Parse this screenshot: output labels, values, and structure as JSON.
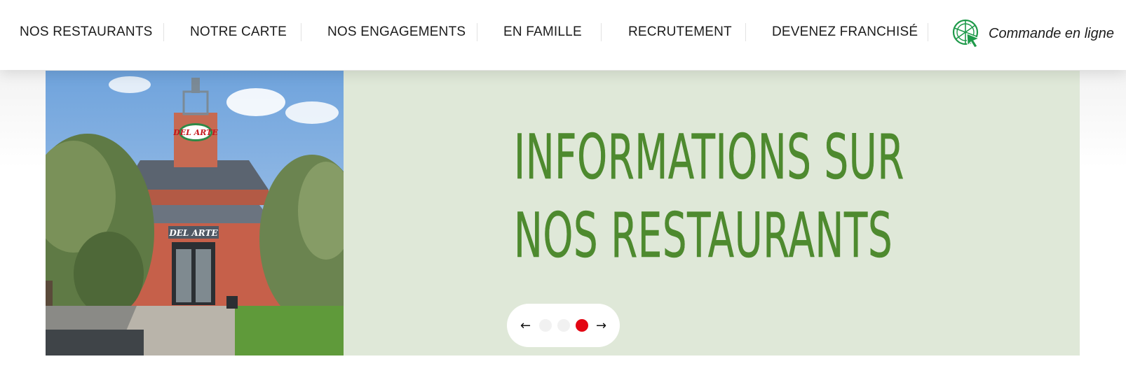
{
  "nav": {
    "items": [
      {
        "label": "NOS RESTAURANTS"
      },
      {
        "label": "NOTRE CARTE"
      },
      {
        "label": "NOS ENGAGEMENTS"
      },
      {
        "label": "EN FAMILLE"
      },
      {
        "label": "RECRUTEMENT"
      },
      {
        "label": "DEVENEZ FRANCHISÉ"
      }
    ],
    "order": {
      "label": "Commande en ligne",
      "icon": "pizza-cursor-icon"
    }
  },
  "banner": {
    "headline_line1": "INFORMATIONS SUR",
    "headline_line2": "NOS RESTAURANTS",
    "sign_text": "DEL ARTE",
    "image": "restaurant-facade-photo"
  },
  "carousel": {
    "prev_icon": "arrow-left-icon",
    "next_icon": "arrow-right-icon",
    "slide_count": 3,
    "active_slide": 3
  },
  "colors": {
    "banner_bg": "#dfe8d8",
    "headline": "#4e8a2f",
    "active_dot": "#e30613",
    "order_icon": "#1f9a4a"
  }
}
